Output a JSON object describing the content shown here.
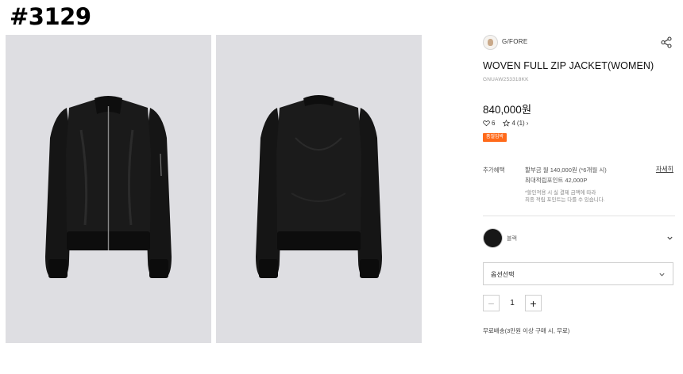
{
  "page_tag": "#3129",
  "gallery": {
    "images": [
      {
        "name": "front-view",
        "background": "#dedee2",
        "garment_color": "#141414"
      },
      {
        "name": "back-view",
        "background": "#dedee2",
        "garment_color": "#141414"
      }
    ]
  },
  "product": {
    "brand": "G/FORE",
    "title": "WOVEN FULL ZIP JACKET(WOMEN)",
    "code": "GNUAW253318KK",
    "price": "840,000원",
    "likes": "6",
    "rating": "4",
    "review_count": "(1)",
    "badge": "품절임박"
  },
  "benefits": {
    "label": "추가혜택",
    "installment": "할부금 월 140,000원 (*6개월 시)",
    "points": "최대적립포인트 42,000P",
    "note_line1": "*할인적용 시 실 결제 금액에 따라",
    "note_line2": "최종 적립 포인트는 다를 수 있습니다.",
    "detail_link": "자세히"
  },
  "color": {
    "name": "블랙",
    "swatch": "#171717"
  },
  "option": {
    "placeholder": "옵션선택"
  },
  "quantity": {
    "value": "1",
    "minus": "−",
    "plus": "+"
  },
  "shipping": {
    "note": "무료배송(3만원 이상 구매 시, 무료)"
  },
  "icons": {
    "share": "share-icon",
    "heart": "heart-icon",
    "star": "star-icon",
    "chevron": "chevron-down-icon"
  },
  "colors": {
    "accent_badge": "#ff6a1a",
    "photo_bg": "#dedee2",
    "border": "#cfcfcf"
  }
}
